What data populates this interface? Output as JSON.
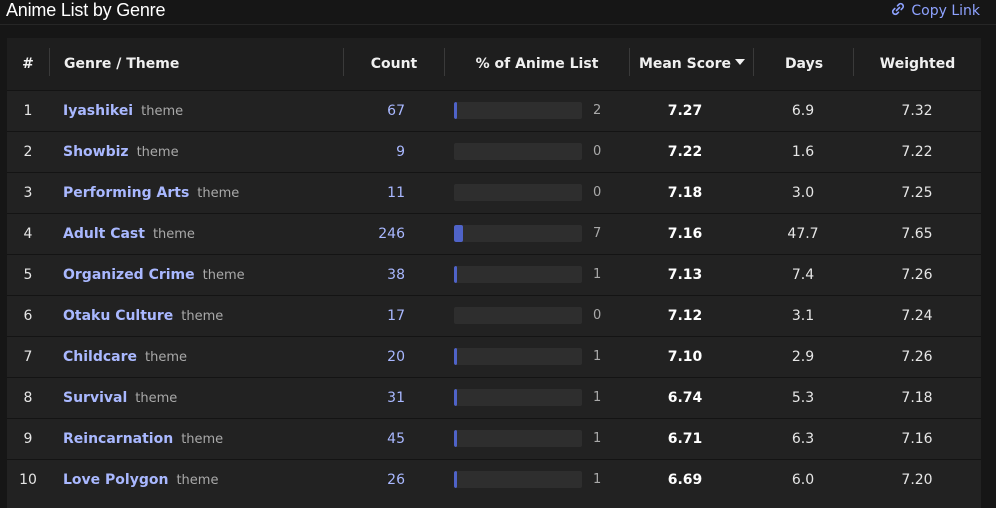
{
  "header": {
    "title": "Anime List by Genre",
    "copy_link_label": "Copy Link",
    "copy_link_icon": "link-icon"
  },
  "table": {
    "columns": {
      "rank": "#",
      "genre": "Genre / Theme",
      "count": "Count",
      "percent": "% of Anime List",
      "mean_score": "Mean Score",
      "days": "Days",
      "weighted": "Weighted"
    },
    "sorted_by": "mean_score",
    "sort_direction": "descending",
    "rows": [
      {
        "rank": "1",
        "genre": "Iyashikei",
        "type": "theme",
        "count": "67",
        "percent_label": "2",
        "percent": 2,
        "mean": "7.27",
        "days": "6.9",
        "weighted": "7.32"
      },
      {
        "rank": "2",
        "genre": "Showbiz",
        "type": "theme",
        "count": "9",
        "percent_label": "0",
        "percent": 0,
        "mean": "7.22",
        "days": "1.6",
        "weighted": "7.22"
      },
      {
        "rank": "3",
        "genre": "Performing Arts",
        "type": "theme",
        "count": "11",
        "percent_label": "0",
        "percent": 0,
        "mean": "7.18",
        "days": "3.0",
        "weighted": "7.25"
      },
      {
        "rank": "4",
        "genre": "Adult Cast",
        "type": "theme",
        "count": "246",
        "percent_label": "7",
        "percent": 7,
        "mean": "7.16",
        "days": "47.7",
        "weighted": "7.65"
      },
      {
        "rank": "5",
        "genre": "Organized Crime",
        "type": "theme",
        "count": "38",
        "percent_label": "1",
        "percent": 1,
        "mean": "7.13",
        "days": "7.4",
        "weighted": "7.26"
      },
      {
        "rank": "6",
        "genre": "Otaku Culture",
        "type": "theme",
        "count": "17",
        "percent_label": "0",
        "percent": 0,
        "mean": "7.12",
        "days": "3.1",
        "weighted": "7.24"
      },
      {
        "rank": "7",
        "genre": "Childcare",
        "type": "theme",
        "count": "20",
        "percent_label": "1",
        "percent": 1,
        "mean": "7.10",
        "days": "2.9",
        "weighted": "7.26"
      },
      {
        "rank": "8",
        "genre": "Survival",
        "type": "theme",
        "count": "31",
        "percent_label": "1",
        "percent": 1,
        "mean": "6.74",
        "days": "5.3",
        "weighted": "7.18"
      },
      {
        "rank": "9",
        "genre": "Reincarnation",
        "type": "theme",
        "count": "45",
        "percent_label": "1",
        "percent": 1,
        "mean": "6.71",
        "days": "6.3",
        "weighted": "7.16"
      },
      {
        "rank": "10",
        "genre": "Love Polygon",
        "type": "theme",
        "count": "26",
        "percent_label": "1",
        "percent": 1,
        "mean": "6.69",
        "days": "6.0",
        "weighted": "7.20"
      }
    ]
  },
  "colors": {
    "background": "#161616",
    "panel": "#222222",
    "accent": "#a9b8ff",
    "bar_fill": "#4f63c8",
    "bar_track": "#2e2e2e"
  }
}
